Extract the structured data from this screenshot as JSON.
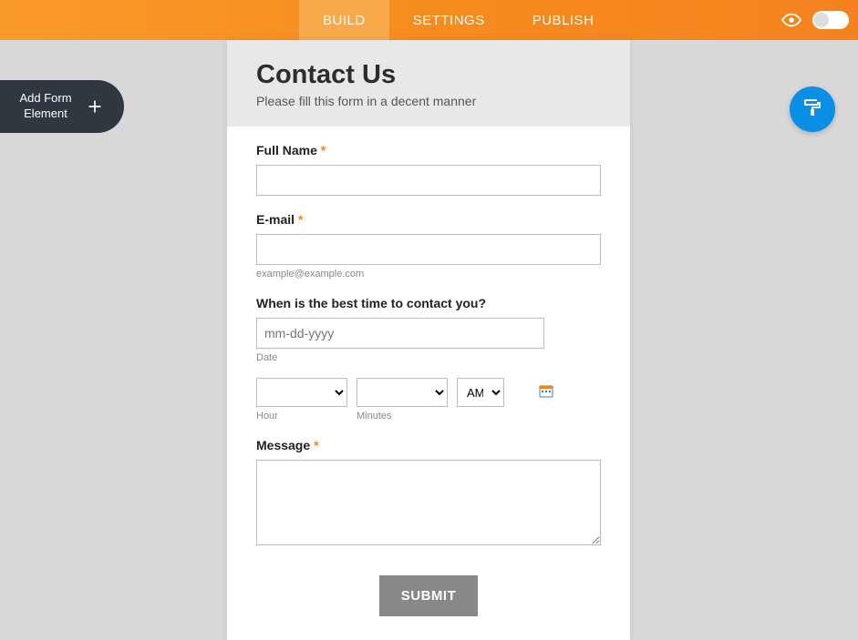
{
  "topbar": {
    "tabs": [
      "BUILD",
      "SETTINGS",
      "PUBLISH"
    ],
    "active_index": 0
  },
  "sidebar": {
    "add_element_label": "Add Form Element"
  },
  "form": {
    "title": "Contact Us",
    "subtitle": "Please fill this form in a decent manner",
    "fields": {
      "full_name": {
        "label": "Full Name",
        "required": true,
        "value": ""
      },
      "email": {
        "label": "E-mail",
        "required": true,
        "value": "",
        "sublabel": "example@example.com"
      },
      "best_time": {
        "label": "When is the best time to contact you?",
        "date_placeholder": "mm-dd-yyyy",
        "date_sublabel": "Date",
        "hour_sublabel": "Hour",
        "minutes_sublabel": "Minutes",
        "ampm_value": "AM"
      },
      "message": {
        "label": "Message",
        "required": true,
        "value": ""
      }
    },
    "submit_label": "SUBMIT"
  }
}
